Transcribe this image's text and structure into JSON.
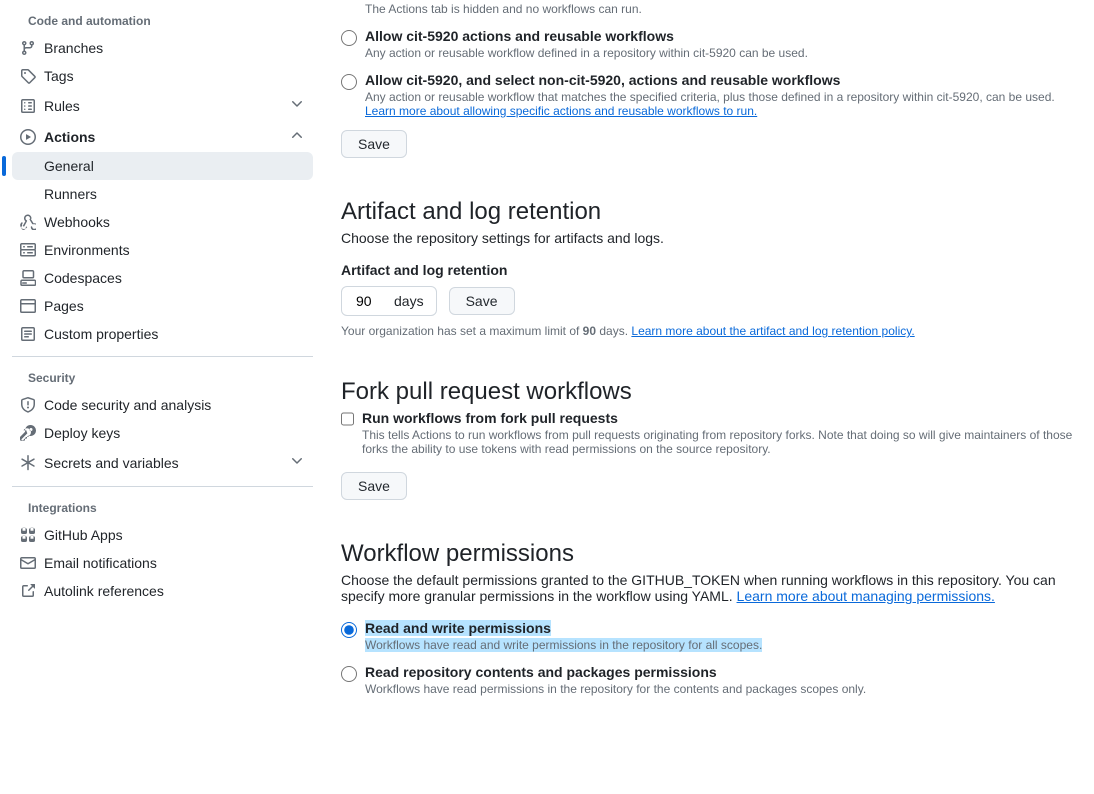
{
  "sidebar": {
    "group1_title": "Code and automation",
    "branches": "Branches",
    "tags": "Tags",
    "rules": "Rules",
    "actions": "Actions",
    "general": "General",
    "runners": "Runners",
    "webhooks": "Webhooks",
    "environments": "Environments",
    "codespaces": "Codespaces",
    "pages": "Pages",
    "custom_properties": "Custom properties",
    "group2_title": "Security",
    "code_security": "Code security and analysis",
    "deploy_keys": "Deploy keys",
    "secrets": "Secrets and variables",
    "group3_title": "Integrations",
    "github_apps": "GitHub Apps",
    "email_notifications": "Email notifications",
    "autolink": "Autolink references"
  },
  "top_desc": "The Actions tab is hidden and no workflows can run.",
  "opt1": {
    "title": "Allow cit-5920 actions and reusable workflows",
    "desc": "Any action or reusable workflow defined in a repository within cit-5920 can be used."
  },
  "opt2": {
    "title": "Allow cit-5920, and select non-cit-5920, actions and reusable workflows",
    "desc": "Any action or reusable workflow that matches the specified criteria, plus those defined in a repository within cit-5920, can be used. ",
    "link": "Learn more about allowing specific actions and reusable workflows to run."
  },
  "save": "Save",
  "artifact": {
    "title": "Artifact and log retention",
    "desc": "Choose the repository settings for artifacts and logs.",
    "label": "Artifact and log retention",
    "value": "90",
    "unit": "days",
    "note_pre": "Your organization has set a maximum limit of ",
    "note_bold": "90",
    "note_post": " days. ",
    "link": "Learn more about the artifact and log retention policy."
  },
  "fork": {
    "title": "Fork pull request workflows",
    "check_label": "Run workflows from fork pull requests",
    "desc": "This tells Actions to run workflows from pull requests originating from repository forks. Note that doing so will give maintainers of those forks the ability to use tokens with read permissions on the source repository."
  },
  "perms": {
    "title": "Workflow permissions",
    "desc_pre": "Choose the default permissions granted to the GITHUB_TOKEN when running workflows in this repository. You can specify more granular permissions in the workflow using YAML. ",
    "link": "Learn more about managing permissions.",
    "opt1_title": "Read and write permissions",
    "opt1_desc": "Workflows have read and write permissions in the repository for all scopes.",
    "opt2_title": "Read repository contents and packages permissions",
    "opt2_desc": "Workflows have read permissions in the repository for the contents and packages scopes only."
  }
}
